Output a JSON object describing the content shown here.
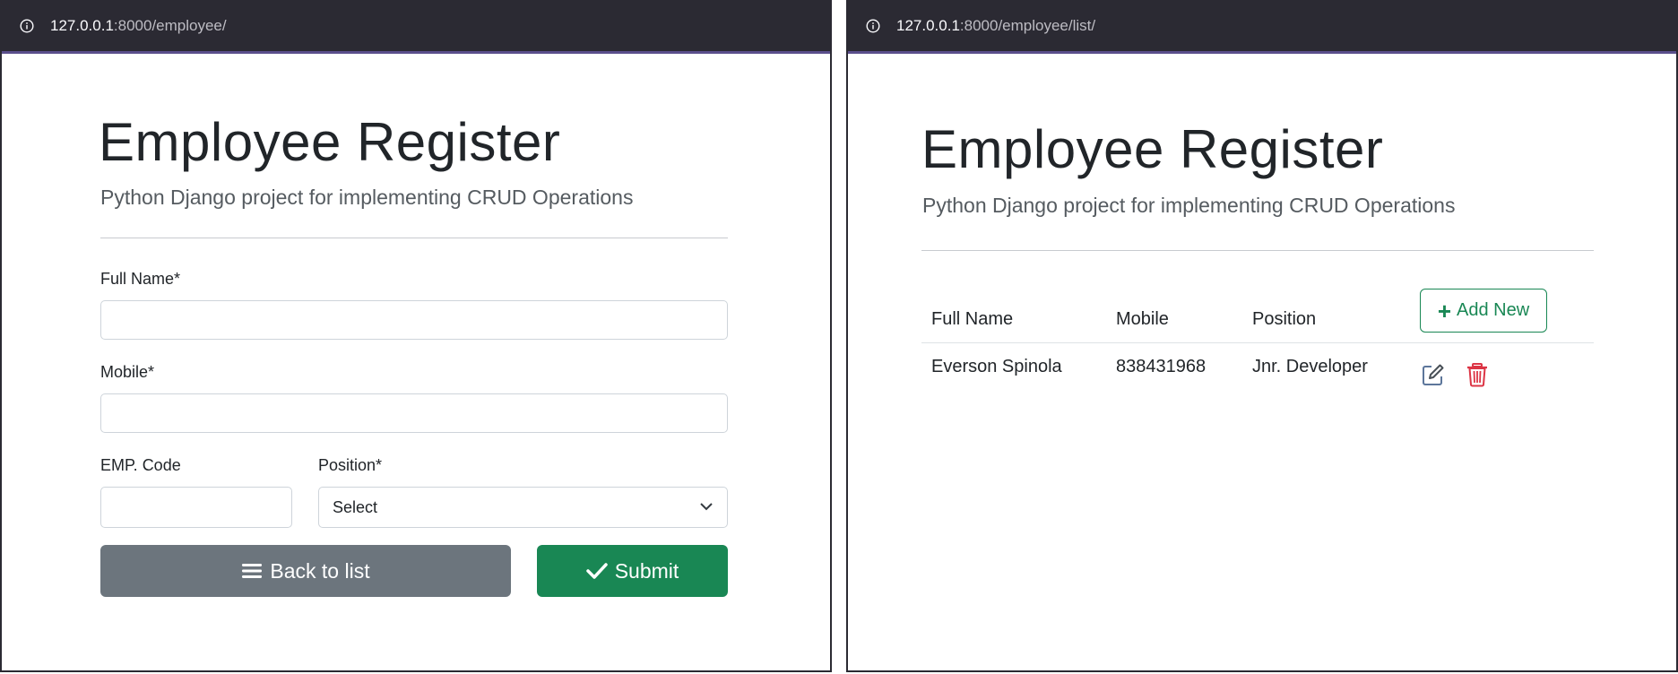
{
  "left_window": {
    "url_host": "127.0.0.1",
    "url_path": ":8000/employee/",
    "title": "Employee Register",
    "subtitle": "Python Django project for implementing CRUD Operations",
    "form": {
      "fullname_label": "Full Name*",
      "fullname_value": "",
      "mobile_label": "Mobile*",
      "mobile_value": "",
      "empcode_label": "EMP. Code",
      "empcode_value": "",
      "position_label": "Position*",
      "position_selected": "Select"
    },
    "buttons": {
      "back_label": "Back to list",
      "submit_label": "Submit"
    }
  },
  "right_window": {
    "url_host": "127.0.0.1",
    "url_path": ":8000/employee/list/",
    "title": "Employee Register",
    "subtitle": "Python Django project for implementing CRUD Operations",
    "table": {
      "headers": [
        "Full Name",
        "Mobile",
        "Position"
      ],
      "add_new_label": "Add New",
      "rows": [
        {
          "fullname": "Everson Spinola",
          "mobile": "838431968",
          "position": "Jnr. Developer"
        }
      ]
    }
  },
  "colors": {
    "browser_bar": "#2b2a33",
    "success": "#198754",
    "secondary": "#6c757d",
    "danger": "#dc3545"
  },
  "icons": [
    "info-icon",
    "list-icon",
    "check-icon",
    "plus-icon",
    "edit-icon",
    "trash-icon",
    "chevron-down-icon"
  ]
}
